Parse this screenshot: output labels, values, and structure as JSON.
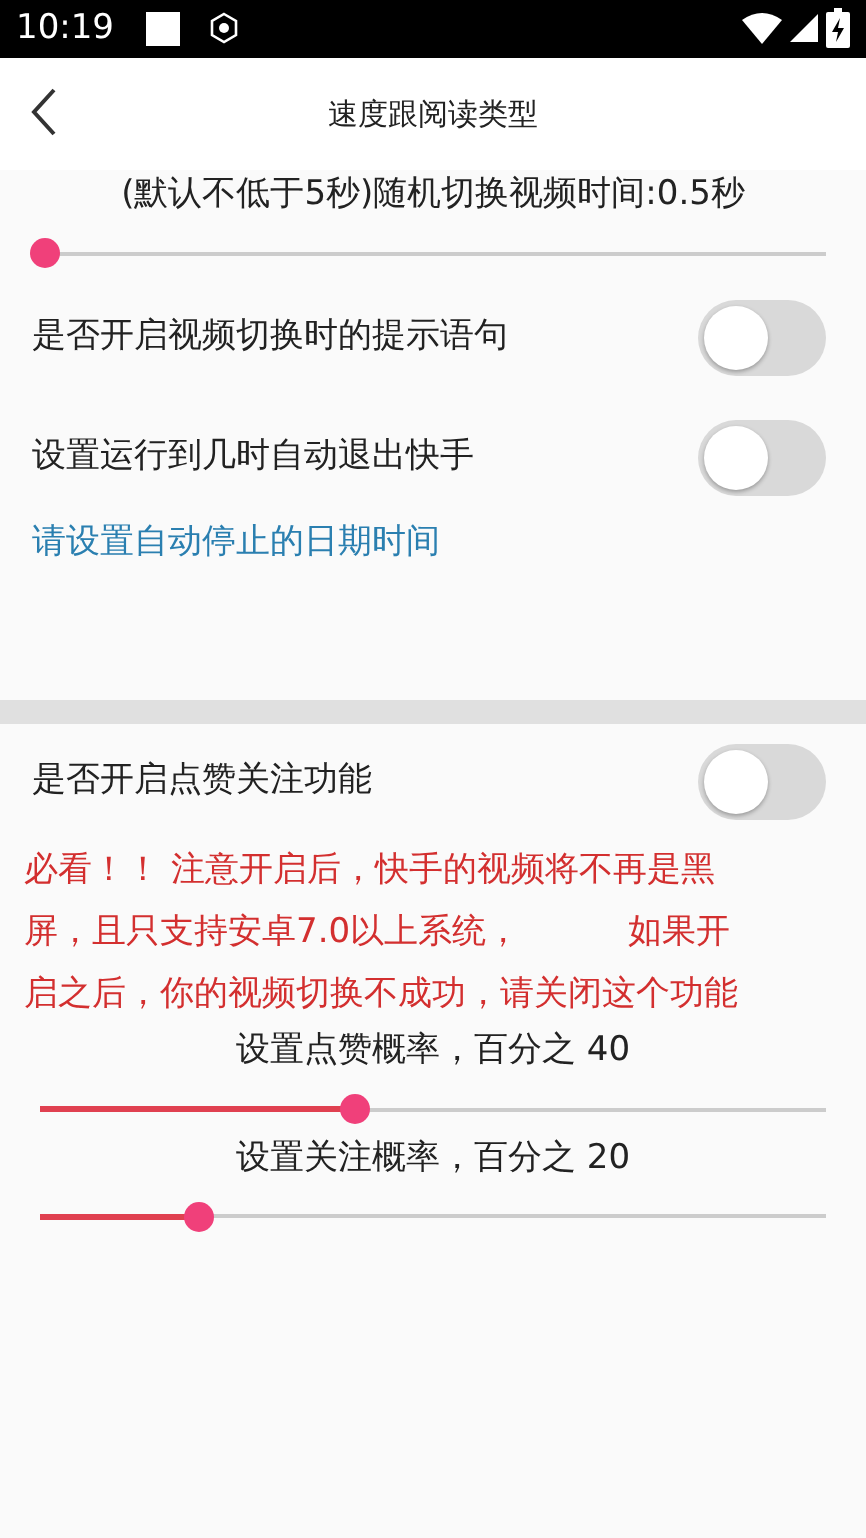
{
  "status_bar": {
    "time": "10:19"
  },
  "header": {
    "title": "速度跟阅读类型"
  },
  "section_1": {
    "slider": {
      "label": "(默认不低于5秒)随机切换视频时间:0.5秒",
      "level": 0.005
    },
    "switches": [
      {
        "label": "是否开启视频切换时的提示语句",
        "on": false
      },
      {
        "label": "设置运行到几时自动退出快手",
        "on": false
      }
    ],
    "link": "请设置自动停止的日期时间"
  },
  "section_2": {
    "switch": {
      "label": "是否开启点赞关注功能",
      "on": false
    },
    "warning_lines": [
      "必看！！ 注意开启后，快手的视频将不再是黑",
      "屏，且只支持安卓7.0以上系统，          如果开",
      "启之后，你的视频切换不成功，请关闭这个功能"
    ],
    "sliders": [
      {
        "label": "设置点赞概率，百分之 40",
        "level": 0.4
      },
      {
        "label": "设置关注概率，百分之 20",
        "level": 0.2
      }
    ]
  }
}
